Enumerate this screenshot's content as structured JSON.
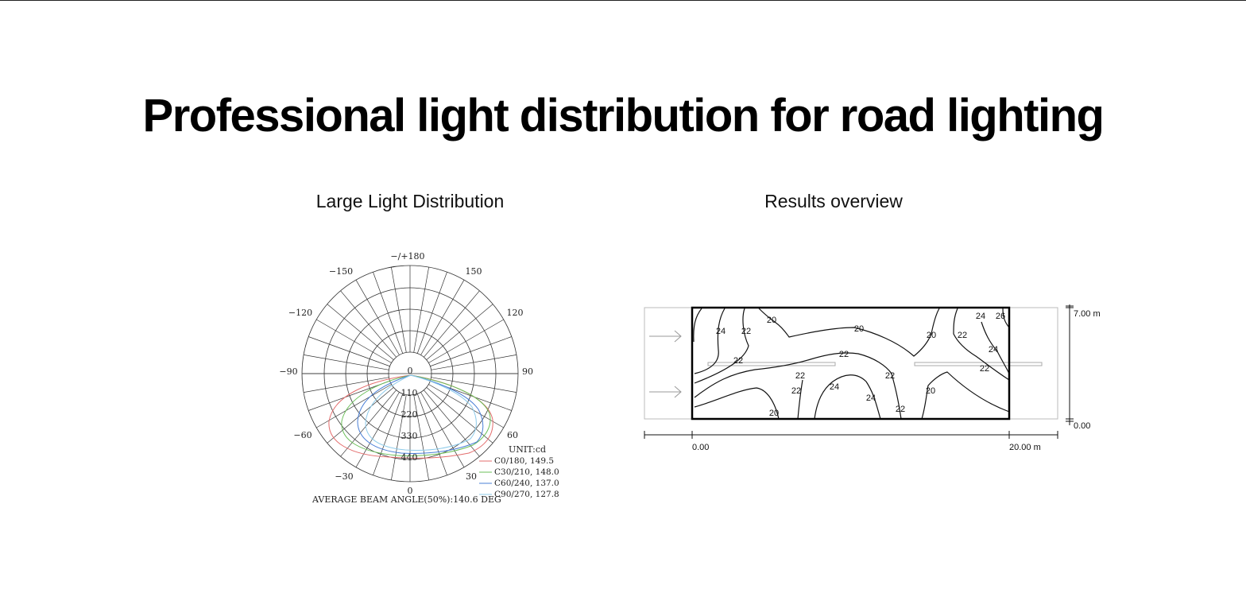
{
  "page": {
    "title": "Professional light distribution for road lighting"
  },
  "polar": {
    "title": "Large Light Distribution",
    "angle_labels": {
      "top": "−/+180",
      "upper_left": "−150",
      "upper_right": "150",
      "mid_upper_left": "−120",
      "mid_upper_right": "120",
      "left": "−90",
      "right": "90",
      "lower_left": "−60",
      "lower_right": "60",
      "bottom_left": "−30",
      "bottom_right": "30",
      "bottom": "0"
    },
    "center_label": "0",
    "radial_labels": [
      "110",
      "220",
      "330",
      "440"
    ],
    "unit": "UNIT:cd",
    "legend": [
      {
        "label": "C0/180, 149.5",
        "color": "#e36c6c"
      },
      {
        "label": "C30/210, 148.0",
        "color": "#6bbf59"
      },
      {
        "label": "C60/240, 137.0",
        "color": "#4a7fd6"
      },
      {
        "label": "C90/270, 127.8",
        "color": "#8ecbea"
      }
    ],
    "footer": "AVERAGE BEAM ANGLE(50%):140.6 DEG"
  },
  "results": {
    "title": "Results overview",
    "contour_labels": [
      "24",
      "22",
      "20",
      "20",
      "20",
      "22",
      "24",
      "26",
      "24",
      "22",
      "22",
      "22",
      "22",
      "22",
      "22",
      "24",
      "24",
      "22",
      "20",
      "20",
      "22"
    ],
    "dim_height": "7.00 m",
    "dim_zero_y": "0.00",
    "dim_zero_x": "0.00",
    "dim_width": "20.00 m"
  },
  "colors": {
    "c0": "#e36c6c",
    "c30": "#6bbf59",
    "c60": "#4a7fd6",
    "c90": "#8ecbea",
    "grid": "#333333"
  }
}
